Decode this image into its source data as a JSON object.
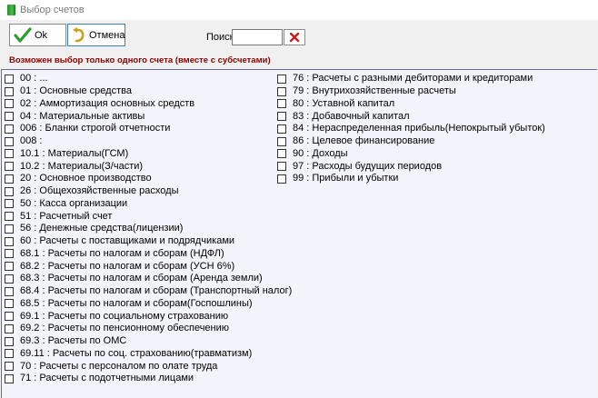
{
  "window": {
    "title": "Выбор счетов"
  },
  "toolbar": {
    "ok_label": "Ok",
    "cancel_label": "Отмена",
    "search_label": "Поиск",
    "search_value": "",
    "search_placeholder": ""
  },
  "notice": "Возможен выбор только одного счета (вместе с субсчетами)",
  "accounts_left": [
    "00 : ...",
    "01 : Основные средства",
    "02 : Аммортизация основных средств",
    "04 : Материальные активы",
    "006 : Бланки строгой отчетности",
    "008 :",
    "10.1 : Материалы(ГСМ)",
    "10.2 : Материалы(З/части)",
    "20 : Основное производство",
    "26 : Общехозяйственные расходы",
    "50 : Касса организации",
    "51 : Расчетный счет",
    "56 : Денежные средства(лицензии)",
    "60 : Расчеты с поставщиками и подрядчиками",
    "68.1 : Расчеты по налогам и сборам (НДФЛ)",
    "68.2 : Расчеты по налогам и сборам (УСН 6%)",
    "68.3 : Расчеты по налогам и сборам (Аренда земли)",
    "68.4 : Расчеты по налогам и сборам (Транспортный налог)",
    "68.5 : Расчеты по налогам и сборам(Госпошлины)",
    "69.1 : Расчеты по социальному страхованию",
    "69.2 : Расчеты по пенсионному обеспечению",
    "69.3 : Расчеты по ОМС",
    "69.11 : Расчеты по соц. страхованию(травматизм)",
    "70 : Расчеты с персоналом по олате труда",
    "71 : Расчеты с подотчетными лицами"
  ],
  "accounts_right": [
    "76 : Расчеты с разными дебиторами и кредиторами",
    "79 : Внутрихозяйственные расчеты",
    "80 : Уставной капитал",
    "83 : Добавочный капитал",
    "84 : Нераспределенная прибыль(Непокрытый убыток)",
    "86 : Целевое финансирование",
    "90 : Доходы",
    "97 : Расходы будущих периодов",
    "99 : Прибыли и убытки"
  ],
  "icons": {
    "ok": "checkmark-icon",
    "cancel": "undo-arrow-icon",
    "clear": "red-x-icon",
    "app": "green-book-icon"
  },
  "colors": {
    "notice": "#8b0000",
    "ok_check": "#2e9e2e",
    "clear_x": "#d11a1a",
    "panel_bg": "#f3f3fb"
  }
}
